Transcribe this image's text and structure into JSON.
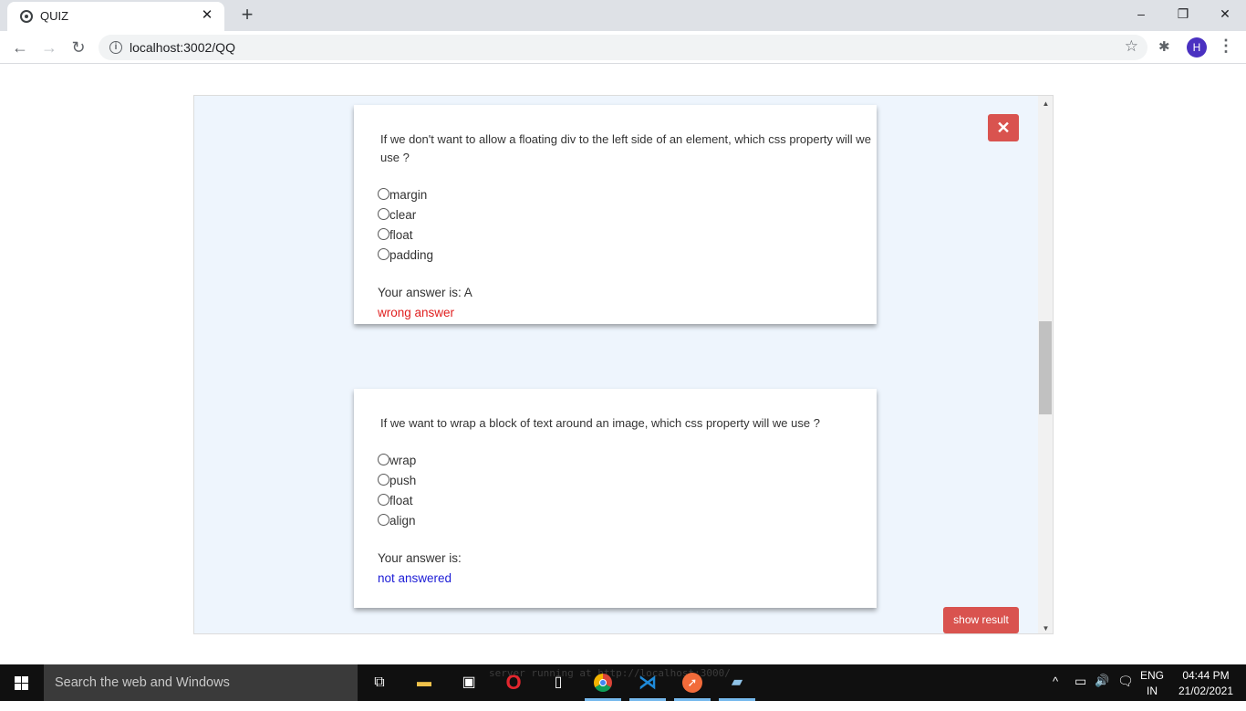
{
  "browser": {
    "tab_title": "QUIZ",
    "tab_close": "✕",
    "new_tab": "+",
    "url": "localhost:3002/QQ",
    "avatar_letter": "H",
    "window_controls": {
      "minimize": "–",
      "restore": "❐",
      "close": "✕"
    },
    "nav": {
      "back": "←",
      "forward": "→",
      "reload": "↻"
    },
    "icons": {
      "info": "i",
      "star": "☆",
      "extensions": "✱",
      "menu": "⋮"
    }
  },
  "quiz": {
    "close_symbol": "✕",
    "questions": [
      {
        "text": "If we don't want to allow a floating div to the left side of an element, which css property will we use ?",
        "options": [
          "margin",
          "clear",
          "float",
          "padding"
        ],
        "answer_label": "Your answer is: A",
        "status": "wrong answer",
        "status_color": "#e01f1f"
      },
      {
        "text": "If we want to wrap a block of text around an image, which css property will we use ?",
        "options": [
          "wrap",
          "push",
          "float",
          "align"
        ],
        "answer_label": "Your answer is:",
        "status": "not answered",
        "status_color": "#1c1cd6"
      }
    ],
    "show_result_label": "show result"
  },
  "taskbar": {
    "search_placeholder": "Search the web and Windows",
    "console_text": "server running at http://localhost:3000/",
    "language_line1": "ENG",
    "language_line2": "IN",
    "time": "04:44 PM",
    "date": "21/02/2021",
    "tray_icons": {
      "chevron": "^",
      "battery": "▭",
      "volume": "🔊",
      "notifications": "🗨"
    }
  },
  "colors": {
    "accent_red": "#d9534f",
    "panel_bg": "#eef5fd",
    "avatar": "#4a31c1"
  }
}
